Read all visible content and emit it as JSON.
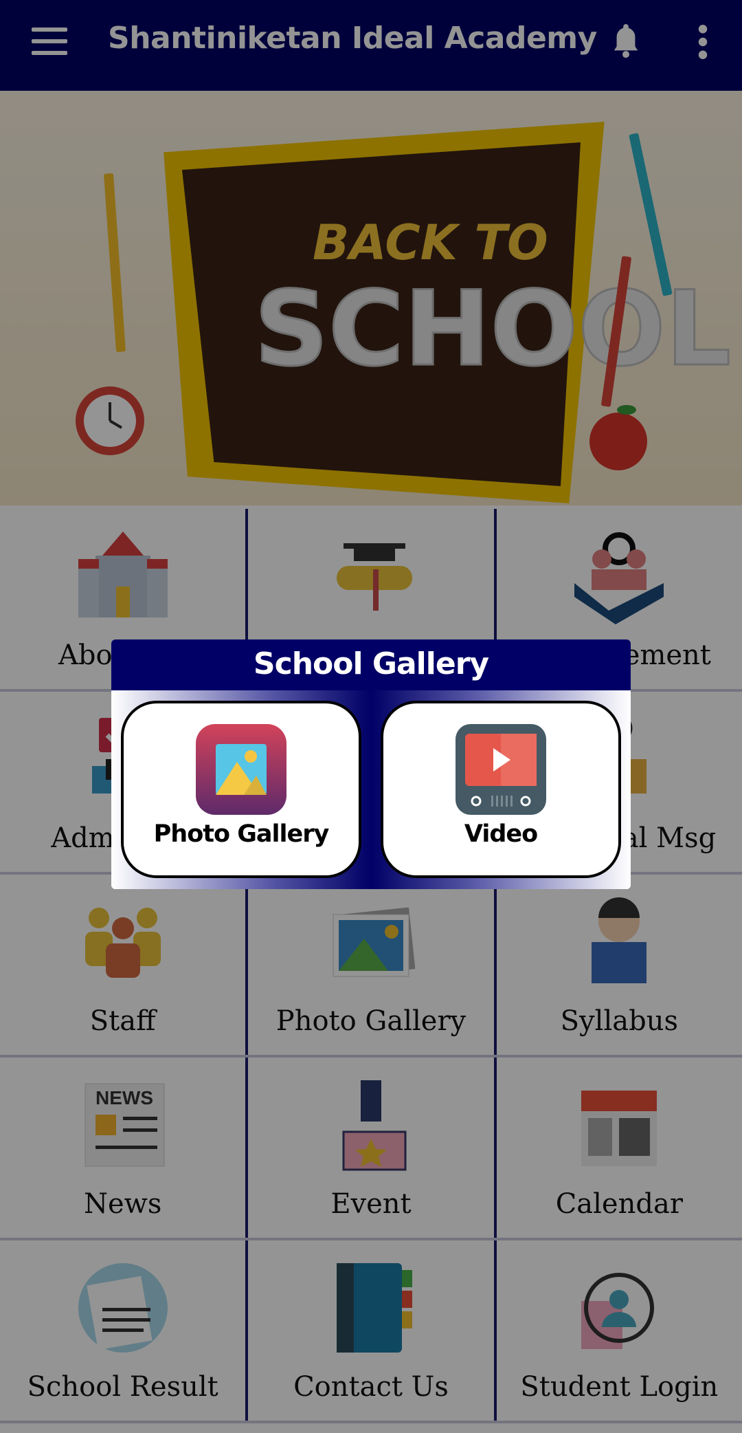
{
  "appbar": {
    "title": "Shantiniketan Ideal Academy",
    "icons": [
      "menu-icon",
      "bell-icon",
      "more-vert-icon"
    ]
  },
  "banner": {
    "line1": "BACK TO",
    "line2": "SCHOOL"
  },
  "grid": {
    "rows": [
      [
        {
          "label": "About Us",
          "icon": "building-icon"
        },
        {
          "label": "",
          "icon": "graduation-icon"
        },
        {
          "label": "Management",
          "icon": "handshake-icon"
        }
      ],
      [
        {
          "label": "Admission",
          "icon": "admission-icon"
        },
        {
          "label": "",
          "icon": "desk-icon"
        },
        {
          "label": "Principal Msg",
          "icon": "clock-desk-icon"
        }
      ],
      [
        {
          "label": "Staff",
          "icon": "staff-icon"
        },
        {
          "label": "Photo Gallery",
          "icon": "photo-icon"
        },
        {
          "label": "Syllabus",
          "icon": "reading-icon"
        }
      ],
      [
        {
          "label": "News",
          "icon": "newspaper-icon"
        },
        {
          "label": "Event",
          "icon": "event-icon"
        },
        {
          "label": "Calendar",
          "icon": "calendar-icon"
        }
      ],
      [
        {
          "label": "School Result",
          "icon": "result-icon"
        },
        {
          "label": "Contact Us",
          "icon": "phonebook-icon"
        },
        {
          "label": "Student Login",
          "icon": "target-user-icon"
        }
      ]
    ]
  },
  "newspaper_text": "NEWS",
  "dialog": {
    "title": "School Gallery",
    "options": [
      {
        "label": "Photo Gallery",
        "icon": "photo-gallery-icon"
      },
      {
        "label": "Video",
        "icon": "video-icon"
      }
    ]
  },
  "colors": {
    "primary": "#000066",
    "accent": "#f3c400"
  }
}
